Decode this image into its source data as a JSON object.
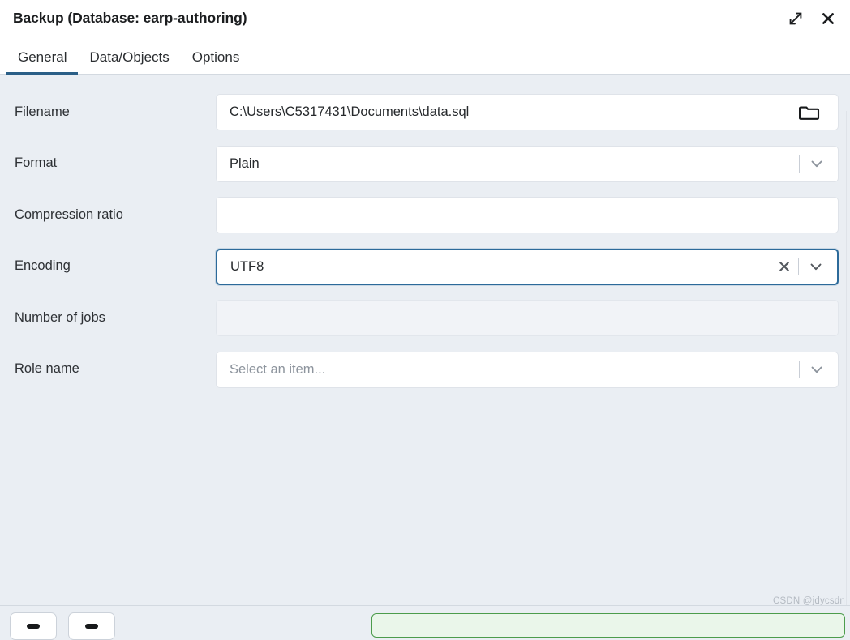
{
  "window": {
    "title": "Backup (Database: earp-authoring)",
    "expand_icon": "expand-diagonal-icon",
    "close_icon": "close-icon"
  },
  "tabs": [
    {
      "label": "General",
      "active": true
    },
    {
      "label": "Data/Objects",
      "active": false
    },
    {
      "label": "Options",
      "active": false
    }
  ],
  "form": {
    "filename": {
      "label": "Filename",
      "value": "C:\\Users\\C5317431\\Documents\\data.sql",
      "browse_icon": "folder-icon"
    },
    "format": {
      "label": "Format",
      "value": "Plain",
      "chevron_icon": "chevron-down-icon"
    },
    "compression_ratio": {
      "label": "Compression ratio",
      "value": ""
    },
    "encoding": {
      "label": "Encoding",
      "value": "UTF8",
      "clear_icon": "close-icon",
      "chevron_icon": "chevron-down-icon",
      "focused": true
    },
    "number_of_jobs": {
      "label": "Number of jobs",
      "value": "",
      "disabled": true
    },
    "role_name": {
      "label": "Role name",
      "value": "",
      "placeholder": "Select an item...",
      "chevron_icon": "chevron-down-icon"
    }
  },
  "footer": {
    "watermark": "CSDN @jdycsdn"
  },
  "colors": {
    "background": "#eaeef3",
    "titlebar": "#ffffff",
    "accent": "#2b5f87",
    "focus_border": "#2c6a9a",
    "field_border": "#dfe3e9",
    "disabled_field": "#f1f3f7",
    "placeholder_text": "#8d949d",
    "green_border": "#4c9c4c",
    "green_fill": "#eaf6ea"
  }
}
